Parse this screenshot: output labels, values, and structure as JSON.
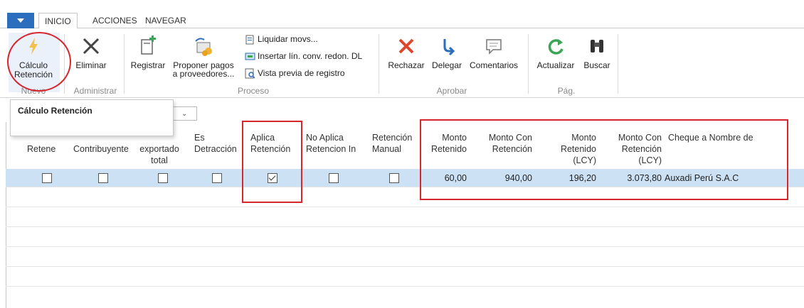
{
  "ribbon": {
    "tabs": [
      "INICIO",
      "ACCIONES",
      "NAVEGAR"
    ],
    "buttons": {
      "calculo": "Cálculo\nRetención",
      "eliminar": "Eliminar",
      "registrar": "Registrar",
      "proponer": "Proponer pagos\na proveedores...",
      "liquidar": "Liquidar movs...",
      "insertar": "Insertar lín. conv. redon. DL",
      "vista_previa": "Vista previa de registro",
      "rechazar": "Rechazar",
      "delegar": "Delegar",
      "comentarios": "Comentarios",
      "actualizar": "Actualizar",
      "buscar": "Buscar"
    },
    "groups": {
      "nuevo": "Nuevo",
      "administrar": "Administrar",
      "proceso": "Proceso",
      "aprobar": "Aprobar",
      "pag": "Pág."
    }
  },
  "tooltip": "Cálculo Retención",
  "grid": {
    "headers": {
      "retene": "Retene",
      "contribuyente": "Contribuyente",
      "exportado": "exportado\ntotal",
      "detraccion": "Es\nDetracción",
      "aplica": "Aplica\nRetención",
      "no_aplica": "No Aplica\nRetencion In",
      "manual": "Retención\nManual",
      "monto_ret": "Monto\nRetenido",
      "monto_con": "Monto Con\nRetención",
      "monto_ret_lcy": "Monto\nRetenido\n(LCY)",
      "monto_con_lcy": "Monto Con\nRetención\n(LCY)",
      "cheque": "Cheque a Nombre de"
    },
    "row": {
      "monto_retenido": "60,00",
      "monto_con_retencion": "940,00",
      "monto_retenido_lcy": "196,20",
      "monto_con_retencion_lcy": "3.073,80",
      "cheque_nombre": "Auxadi Perú S.A.C",
      "checks": [
        false,
        false,
        false,
        false,
        true,
        false,
        false
      ]
    }
  },
  "colors": {
    "accent": "#2a6ebd",
    "selected_row": "#cde1f4",
    "highlight": "#d8262e"
  }
}
